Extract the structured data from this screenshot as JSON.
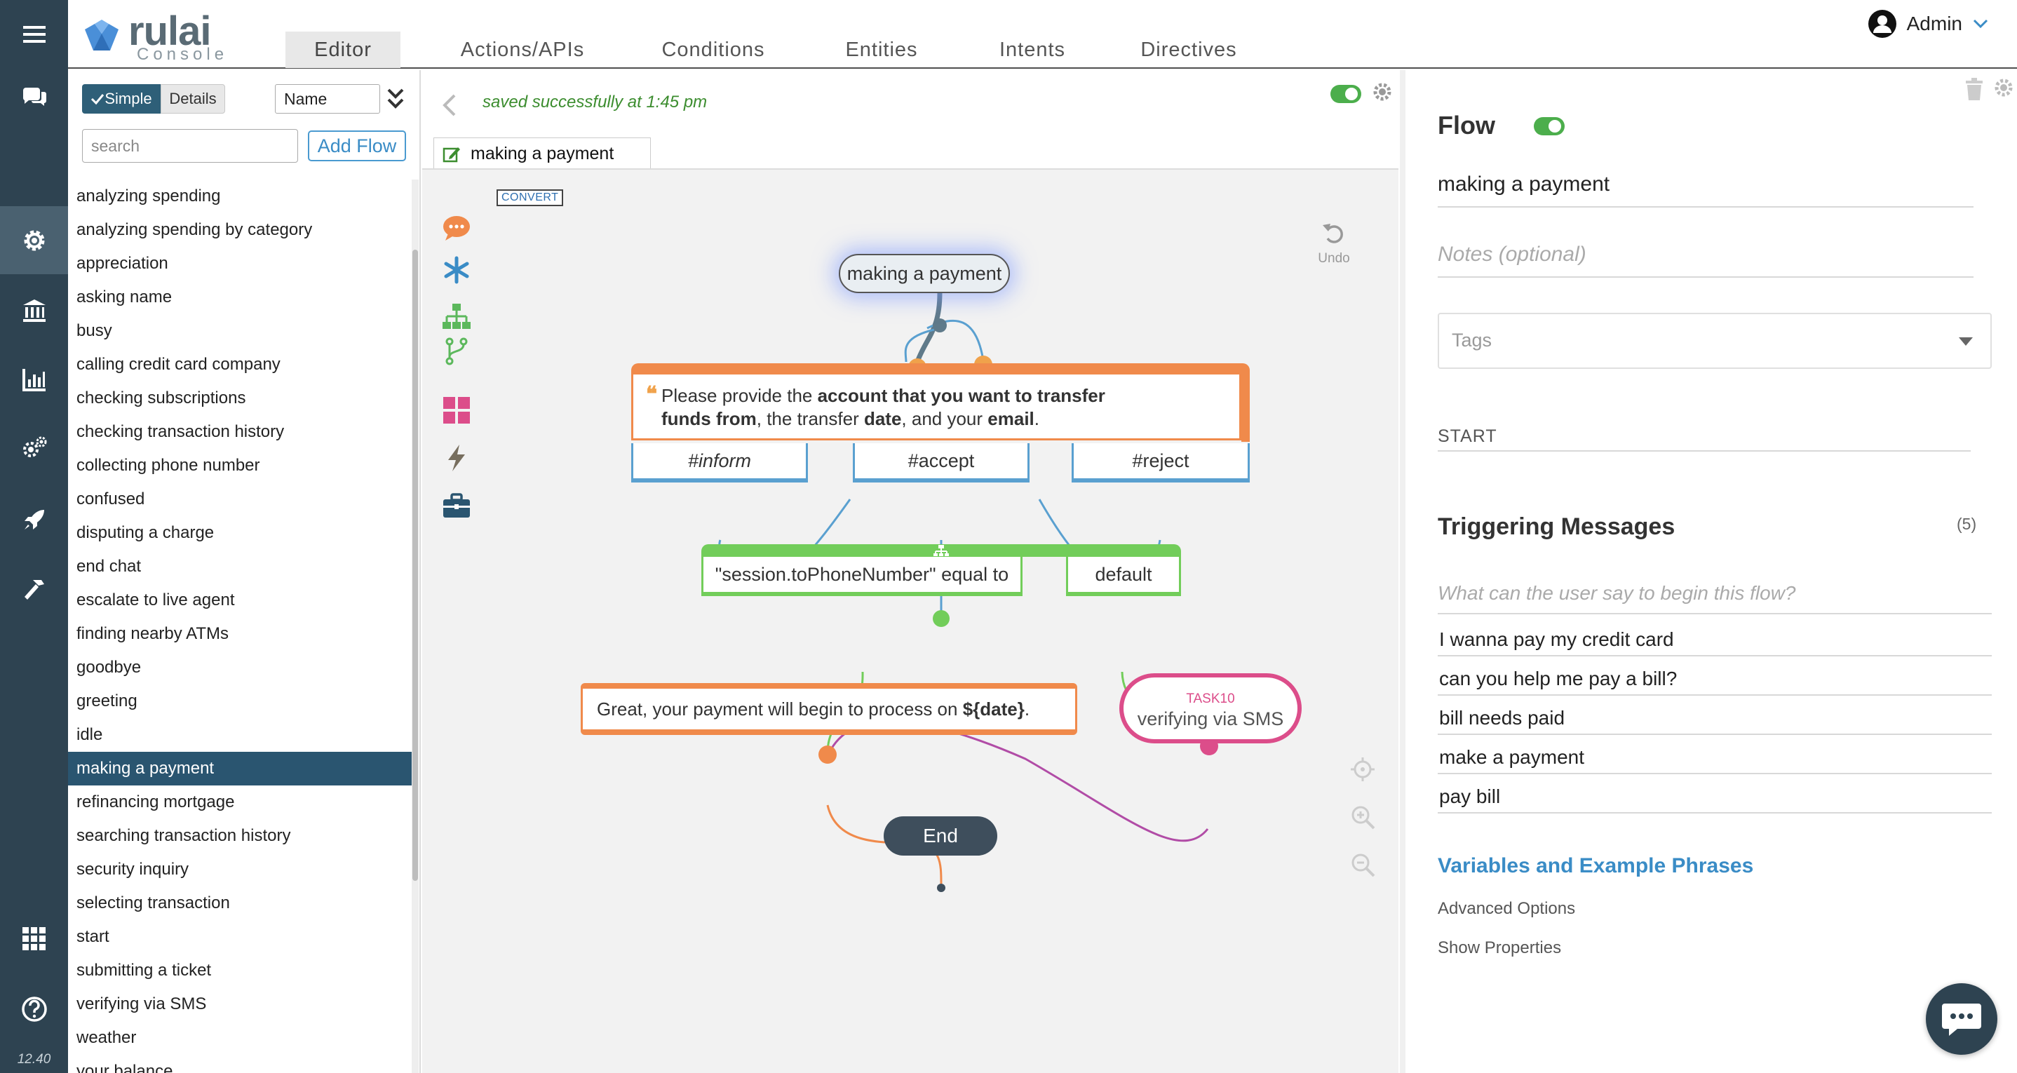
{
  "app": {
    "logo_text": "rulai",
    "logo_sub": "Console",
    "version": "12.40",
    "user": "Admin"
  },
  "nav": {
    "tabs": [
      {
        "label": "Editor",
        "active": true
      },
      {
        "label": "Actions/APIs"
      },
      {
        "label": "Conditions"
      },
      {
        "label": "Entities"
      },
      {
        "label": "Intents"
      },
      {
        "label": "Directives"
      }
    ]
  },
  "rail": {
    "icons": [
      "menu-icon",
      "chat-icon",
      "gear-icon",
      "bank-icon",
      "chart-icon",
      "settings-icon",
      "rocket-icon",
      "hammer-icon",
      "apps-grid-icon",
      "help-icon"
    ]
  },
  "flows": {
    "mode_simple": "Simple",
    "mode_details": "Details",
    "sort_value": "Name",
    "search_placeholder": "search",
    "add_flow": "Add Flow",
    "items": [
      "analyzing spending",
      "analyzing spending by category",
      "appreciation",
      "asking name",
      "busy",
      "calling credit card company",
      "checking subscriptions",
      "checking transaction history",
      "collecting phone number",
      "confused",
      "disputing a charge",
      "end chat",
      "escalate to live agent",
      "finding nearby ATMs",
      "goodbye",
      "greeting",
      "idle",
      "making a payment",
      "refinancing mortgage",
      "searching transaction history",
      "security inquiry",
      "selecting transaction",
      "start",
      "submitting a ticket",
      "verifying via SMS",
      "weather",
      "your balance"
    ],
    "selected": "making a payment"
  },
  "editor": {
    "save_status": "saved successfully at 1:45 pm",
    "tab_label": "making a payment",
    "convert": "CONVERT",
    "undo": "Undo",
    "nodes": {
      "start": "making a payment",
      "prompt_parts": [
        "Please provide the ",
        "account that you want to transfer",
        "funds from",
        ", the transfer ",
        "date",
        ", and your ",
        "email",
        "."
      ],
      "intents": [
        "#inform",
        "#accept",
        "#reject"
      ],
      "condition": "\"session.toPhoneNumber\" equal to",
      "default": "default",
      "message_prefix": "Great, your payment will begin to process on ",
      "message_var": "${date}",
      "message_suffix": ".",
      "task_tag": "TASK10",
      "task_name": "verifying via SMS",
      "end": "End"
    },
    "colors": {
      "prompt": "#f08a4b",
      "intent": "#5aa0d0",
      "condition": "#72cd5a",
      "task": "#dc4d8a"
    }
  },
  "props": {
    "title": "Flow",
    "name": "making a payment",
    "notes_placeholder": "Notes (optional)",
    "tags_placeholder": "Tags",
    "start_label": "START",
    "triggering_title": "Triggering Messages",
    "triggering_count": "(5)",
    "triggering_placeholder": "What can the user say to begin this flow?",
    "triggering": [
      "I wanna pay my credit card",
      "can you help me pay a bill?",
      "bill needs paid",
      "make a payment",
      "pay bill"
    ],
    "vars_link": "Variables and Example Phrases",
    "advanced": "Advanced Options",
    "show_props": "Show Properties"
  }
}
